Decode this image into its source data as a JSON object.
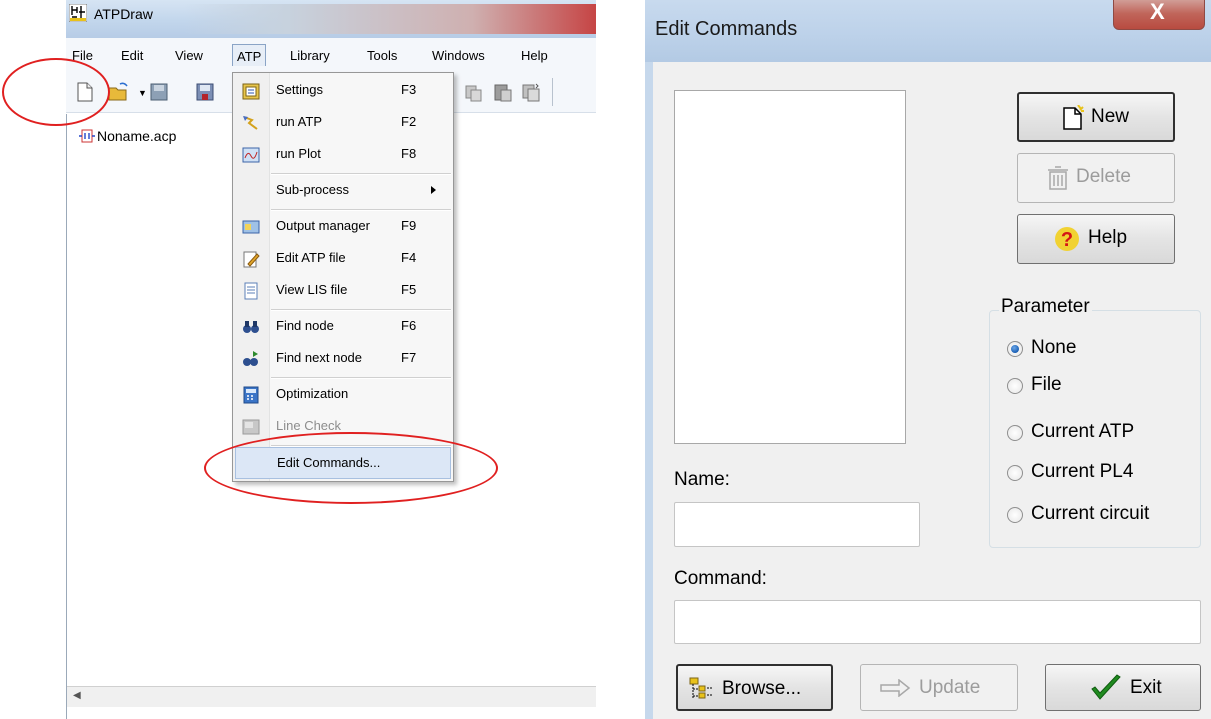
{
  "atp_window": {
    "title": "ATPDraw",
    "menu": [
      "File",
      "Edit",
      "View",
      "ATP",
      "Library",
      "Tools",
      "Windows",
      "Help"
    ],
    "active_menu": "ATP",
    "document_tab": "Noname.acp",
    "dropdown": [
      {
        "label": "Settings",
        "shortcut": "F3",
        "icon": "settings-icon"
      },
      {
        "label": "run ATP",
        "shortcut": "F2",
        "icon": "run-atp-icon"
      },
      {
        "label": "run Plot",
        "shortcut": "F8",
        "icon": "run-plot-icon"
      },
      {
        "label": "Sub-process",
        "shortcut": "",
        "icon": ""
      },
      {
        "label": "Output manager",
        "shortcut": "F9",
        "icon": "output-manager-icon"
      },
      {
        "label": "Edit ATP file",
        "shortcut": "F4",
        "icon": "edit-file-icon"
      },
      {
        "label": "View LIS file",
        "shortcut": "F5",
        "icon": "view-file-icon"
      },
      {
        "label": "Find node",
        "shortcut": "F6",
        "icon": "binoculars-icon"
      },
      {
        "label": "Find next node",
        "shortcut": "F7",
        "icon": "find-next-icon"
      },
      {
        "label": "Optimization",
        "shortcut": "",
        "icon": "calculator-icon"
      },
      {
        "label": "Line Check",
        "shortcut": "",
        "icon": "line-check-icon"
      },
      {
        "label": "Edit Commands...",
        "shortcut": "",
        "icon": ""
      }
    ]
  },
  "dialog": {
    "title": "Edit Commands",
    "close_glyph": "X",
    "buttons": {
      "new": "New",
      "delete": "Delete",
      "help": "Help",
      "browse": "Browse...",
      "update": "Update",
      "exit": "Exit"
    },
    "parameter_group": {
      "label": "Parameter",
      "options": [
        "None",
        "File",
        "Current ATP",
        "Current PL4",
        "Current circuit"
      ],
      "selected": "None"
    },
    "name_label": "Name:",
    "name_value": "",
    "command_label": "Command:",
    "command_value": ""
  },
  "colors": {
    "annotation_red": "#e02020",
    "menu_highlight": "#dce7f6",
    "radio_selected": "#1a5fb4"
  }
}
